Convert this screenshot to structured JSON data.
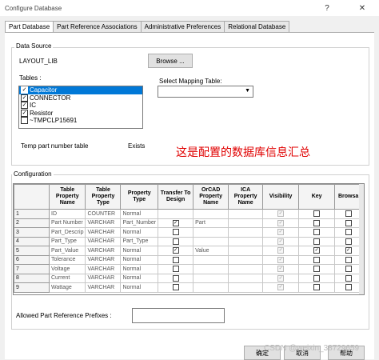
{
  "window": {
    "title": "Configure Database",
    "help": "?",
    "close": "✕"
  },
  "tabs": [
    "Part Database",
    "Part Reference Associations",
    "Administrative Preferences",
    "Relational Database"
  ],
  "data_source": {
    "group_label": "Data Source",
    "source_name": "LAYOUT_LIB",
    "browse_label": "Browse ...",
    "tables_label": "Tables :",
    "tables": [
      {
        "label": "Capacitor",
        "checked": true,
        "selected": true
      },
      {
        "label": "CONNECTOR",
        "checked": true,
        "selected": false
      },
      {
        "label": "IC",
        "checked": true,
        "selected": false
      },
      {
        "label": "Resistor",
        "checked": true,
        "selected": false
      },
      {
        "label": "~TMPCLP15691",
        "checked": false,
        "selected": false
      }
    ],
    "mapping_label": "Select Mapping Table:",
    "mapping_value": "",
    "temp_label": "Temp part number table",
    "exists_label": "Exists"
  },
  "annotation": "这是配置的数据库信息汇总",
  "configuration": {
    "group_label": "Configuration",
    "columns": [
      "",
      "Table Property Name",
      "Table Property Type",
      "Property Type",
      "Transfer To Design",
      "OrCAD Property Name",
      "ICA Property Name",
      "Visibility",
      "Key",
      "Browsa"
    ],
    "rows": [
      {
        "num": "1",
        "name": "ID",
        "ttype": "COUNTER",
        "ptype": "Normal",
        "transfer": null,
        "orcad": "",
        "ica": "",
        "vis": true,
        "key": false,
        "browse": false
      },
      {
        "num": "2",
        "name": "Part Number",
        "ttype": "VARCHAR",
        "ptype": "Part_Number",
        "transfer": true,
        "orcad": "Part",
        "ica": "",
        "vis": true,
        "key": false,
        "browse": false
      },
      {
        "num": "3",
        "name": "Part_Descrip",
        "ttype": "VARCHAR",
        "ptype": "Normal",
        "transfer": false,
        "orcad": "",
        "ica": "",
        "vis": true,
        "key": false,
        "browse": false
      },
      {
        "num": "4",
        "name": "Part_Type",
        "ttype": "VARCHAR",
        "ptype": "Part_Type",
        "transfer": false,
        "orcad": "",
        "ica": "",
        "vis": true,
        "key": false,
        "browse": false
      },
      {
        "num": "5",
        "name": "Part_Value",
        "ttype": "VARCHAR",
        "ptype": "Normal",
        "transfer": true,
        "orcad": "Value",
        "ica": "",
        "vis": true,
        "key": true,
        "browse": true
      },
      {
        "num": "6",
        "name": "Tolerance",
        "ttype": "VARCHAR",
        "ptype": "Normal",
        "transfer": false,
        "orcad": "",
        "ica": "",
        "vis": true,
        "key": false,
        "browse": false
      },
      {
        "num": "7",
        "name": "Voltage",
        "ttype": "VARCHAR",
        "ptype": "Normal",
        "transfer": false,
        "orcad": "",
        "ica": "",
        "vis": true,
        "key": false,
        "browse": false
      },
      {
        "num": "8",
        "name": "Current",
        "ttype": "VARCHAR",
        "ptype": "Normal",
        "transfer": false,
        "orcad": "",
        "ica": "",
        "vis": true,
        "key": false,
        "browse": false
      },
      {
        "num": "9",
        "name": "Wattage",
        "ttype": "VARCHAR",
        "ptype": "Normal",
        "transfer": false,
        "orcad": "",
        "ica": "",
        "vis": true,
        "key": false,
        "browse": false
      }
    ],
    "prefix_label": "Allowed Part Reference Prefixes :",
    "prefix_value": ""
  },
  "footer": {
    "ok": "确定",
    "cancel": "取消",
    "help": "帮助"
  },
  "watermark": "CSDN @weixin_38729659"
}
